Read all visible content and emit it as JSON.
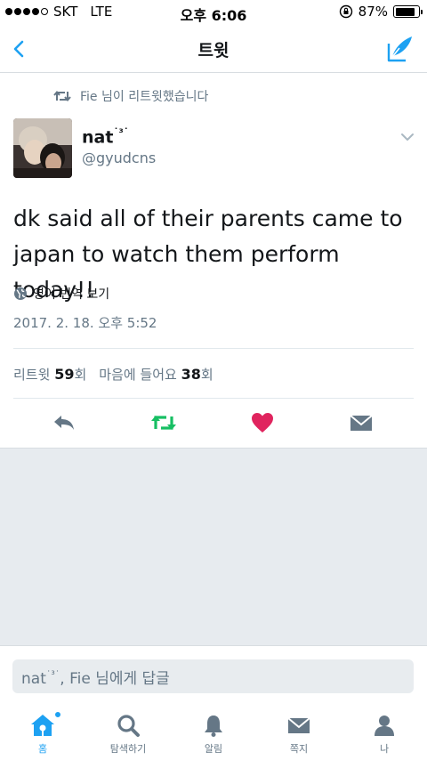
{
  "status_bar": {
    "carrier": "SKT",
    "network": "LTE",
    "time": "오후 6:06",
    "battery_percent": "87%",
    "battery_level": 0.87
  },
  "nav": {
    "title": "트윗",
    "back_icon": "chevron-left-icon",
    "compose_icon": "compose-icon"
  },
  "retweet_context": {
    "text": "Fie 님이 리트윗했습니다"
  },
  "tweet": {
    "display_name": "nat",
    "display_name_suffix": "˙³˙",
    "handle": "@gyudcns",
    "text": "dk said all of their parents came to japan to watch them perform today!!",
    "translate_label": "영어 번역 보기",
    "timestamp": "2017. 2. 18. 오후 5:52"
  },
  "stats": {
    "retweets_label": "리트윗",
    "retweets_count": "59",
    "retweets_unit": "회",
    "likes_label": "마음에 들어요",
    "likes_count": "38",
    "likes_unit": "회"
  },
  "reply": {
    "placeholder_name": "nat",
    "placeholder_suffix": "˙³˙",
    "placeholder_rest": ", Fie 님에게 답글"
  },
  "tabs": [
    {
      "label": "홈",
      "icon": "home-icon"
    },
    {
      "label": "탐색하기",
      "icon": "search-icon"
    },
    {
      "label": "알림",
      "icon": "bell-icon"
    },
    {
      "label": "쪽지",
      "icon": "envelope-icon"
    },
    {
      "label": "나",
      "icon": "person-icon"
    }
  ],
  "colors": {
    "accent": "#1da1f2",
    "retweet_green": "#17bf63",
    "like_red": "#e0245e",
    "muted": "#657786"
  }
}
